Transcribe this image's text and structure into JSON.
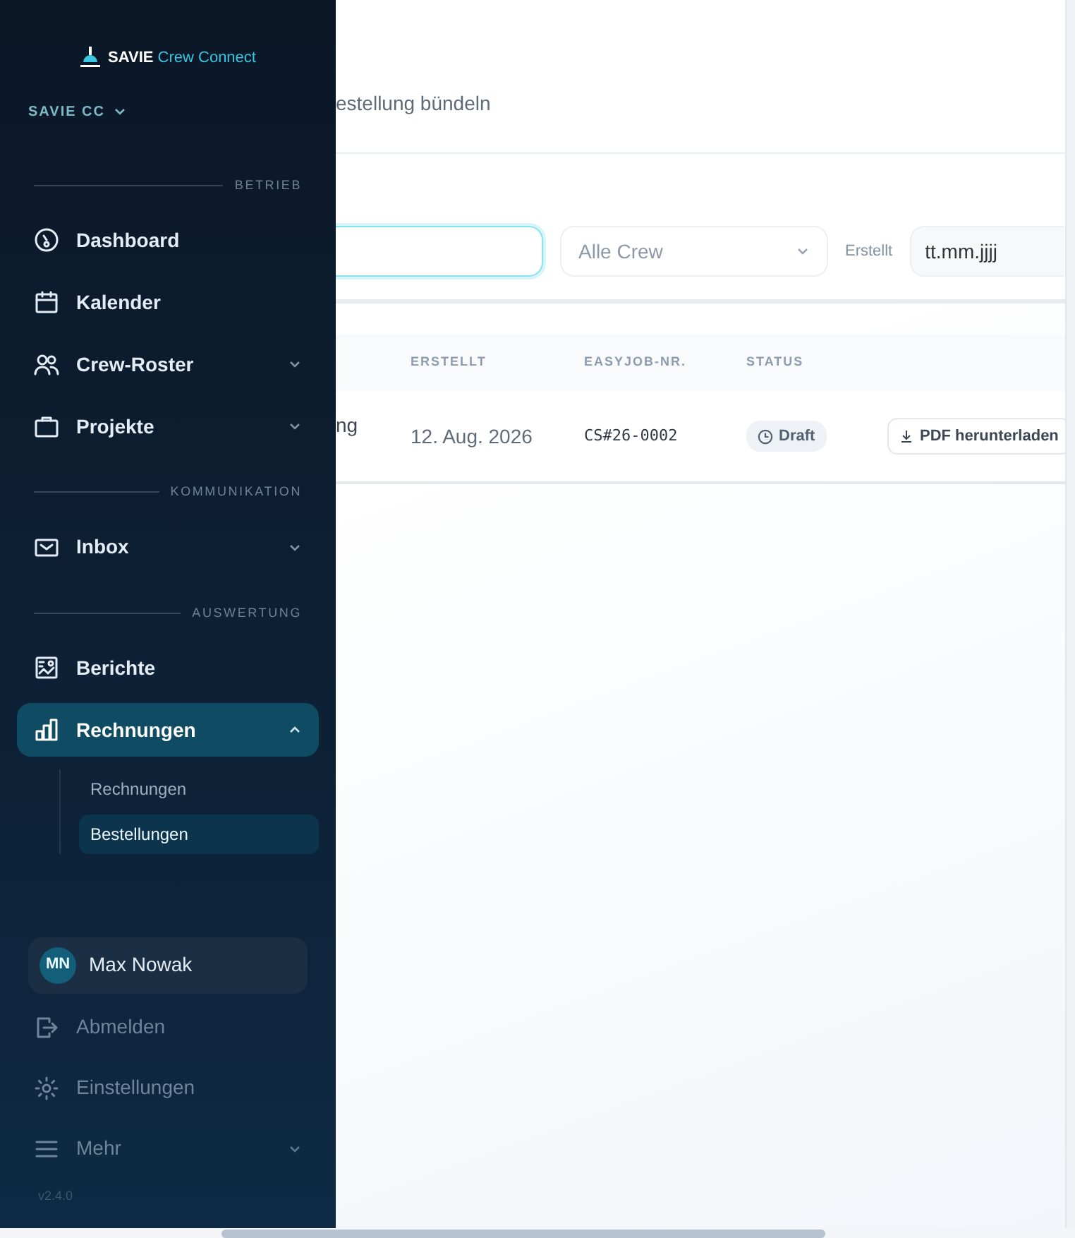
{
  "sidebar": {
    "brand": {
      "strong": "SAVIE",
      "light": "Crew Connect"
    },
    "workspace": "SAVIE CC",
    "sections": [
      {
        "heading": "BETRIEB",
        "items": [
          {
            "label": "Dashboard",
            "selected": false
          },
          {
            "label": "Kalender",
            "selected": false
          },
          {
            "label": "Crew-Roster",
            "expanded": false,
            "selected": false
          },
          {
            "label": "Projekte",
            "expanded": false,
            "selected": false
          }
        ]
      },
      {
        "heading": "KOMMUNIKATION",
        "items": [
          {
            "label": "Inbox",
            "expanded": false,
            "selected": false
          }
        ]
      },
      {
        "heading": "AUSWERTUNG",
        "items": [
          {
            "label": "Berichte",
            "selected": false
          },
          {
            "label": "Rechnungen",
            "expanded": true,
            "selected": true,
            "children": [
              {
                "label": "Rechnungen",
                "selected": false
              },
              {
                "label": "Bestellungen",
                "selected": true
              }
            ]
          }
        ]
      }
    ],
    "user": {
      "initials": "MN",
      "name": "Max Nowak"
    },
    "footer_items": [
      {
        "label": "Abmelden"
      },
      {
        "label": "Einstellungen"
      },
      {
        "label": "Mehr",
        "expanded": false
      }
    ],
    "version": "v2.4.0"
  },
  "main": {
    "header_text": "estellung bündeln",
    "filters": {
      "crew_select": {
        "placeholder": "Alle Crew"
      },
      "date_label": "Erstellt",
      "date_field": {
        "placeholder": "tt.mm.jjjj"
      }
    },
    "table": {
      "columns": [
        "ERSTELLT",
        "EASYJOB-NR.",
        "STATUS"
      ],
      "rows": [
        {
          "name_fragment": "ng",
          "created": "12. Aug. 2026",
          "easyjob": "CS#26-0002",
          "status": "Draft",
          "action": "PDF herunterladen"
        }
      ]
    }
  }
}
